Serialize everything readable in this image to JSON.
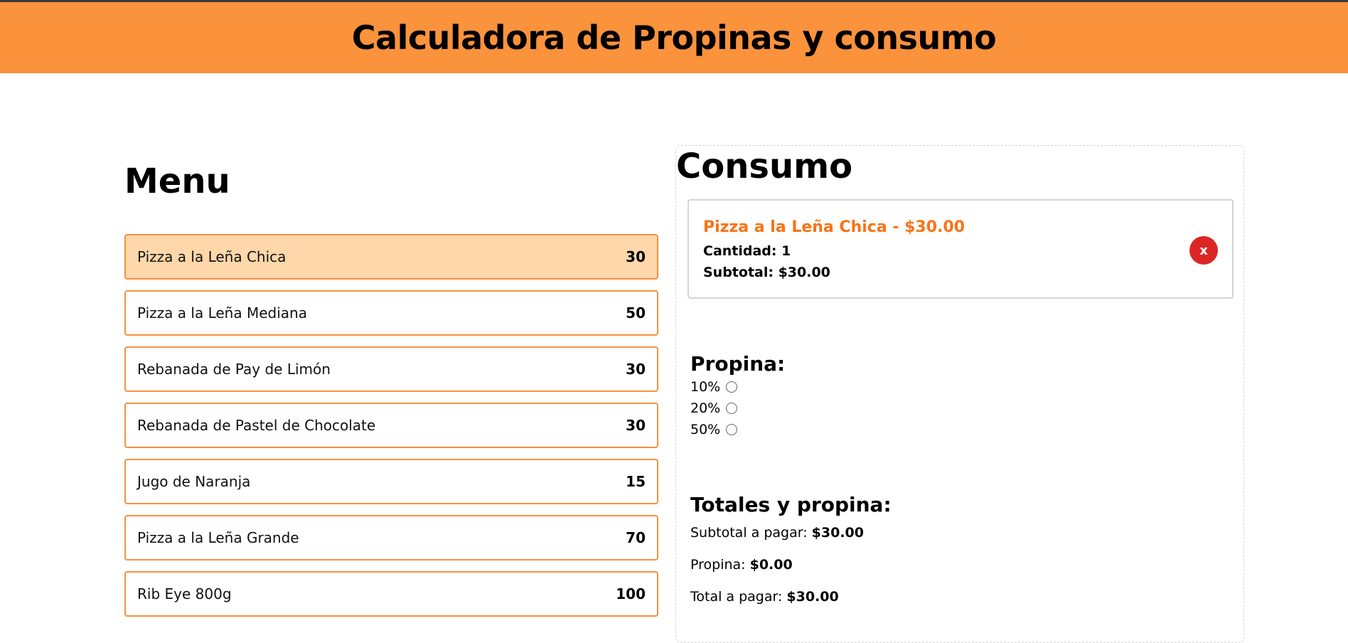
{
  "header": {
    "title": "Calculadora de Propinas y consumo"
  },
  "menu": {
    "title": "Menu",
    "items": [
      {
        "name": "Pizza a la Leña Chica",
        "price": "30",
        "selected": true
      },
      {
        "name": "Pizza a la Leña Mediana",
        "price": "50",
        "selected": false
      },
      {
        "name": "Rebanada de Pay de Limón",
        "price": "30",
        "selected": false
      },
      {
        "name": "Rebanada de Pastel de Chocolate",
        "price": "30",
        "selected": false
      },
      {
        "name": "Jugo de Naranja",
        "price": "15",
        "selected": false
      },
      {
        "name": "Pizza a la Leña Grande",
        "price": "70",
        "selected": false
      },
      {
        "name": "Rib Eye 800g",
        "price": "100",
        "selected": false
      }
    ]
  },
  "consumo": {
    "title": "Consumo",
    "orders": [
      {
        "title": "Pizza a la Leña Chica - $30.00",
        "quantity": "Cantidad: 1",
        "subtotal": "Subtotal: $30.00",
        "remove_label": "x"
      }
    ],
    "tip": {
      "title": "Propina:",
      "options": [
        {
          "label": "10%",
          "checked": false
        },
        {
          "label": "20%",
          "checked": false
        },
        {
          "label": "50%",
          "checked": false
        }
      ]
    },
    "totals": {
      "title": "Totales y propina:",
      "subtotal_label": "Subtotal a pagar:",
      "subtotal_value": "$30.00",
      "tip_label": "Propina:",
      "tip_value": "$0.00",
      "total_label": "Total a pagar:",
      "total_value": "$30.00"
    }
  },
  "colors": {
    "header_bg": "#fb923c",
    "accent": "#f97316",
    "selected_bg": "#fed7aa",
    "remove_btn": "#dc2626"
  }
}
